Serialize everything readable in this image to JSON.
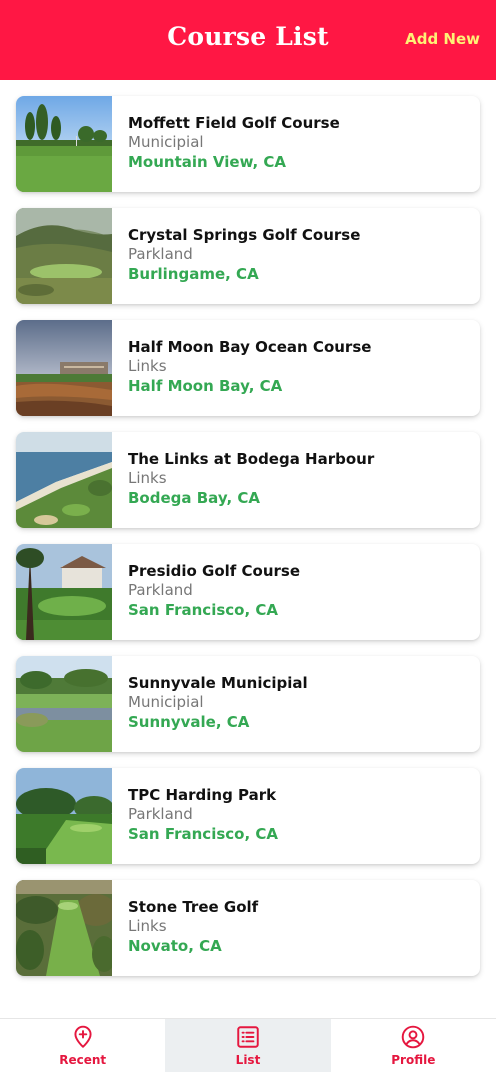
{
  "header": {
    "title": "Course List",
    "add_new_label": "Add New"
  },
  "colors": {
    "header_bg": "#ff1744",
    "add_new": "#fff176",
    "location_text": "#34a853",
    "tab_active_bg": "#eceff1",
    "tab_text": "#e5173f"
  },
  "courses": [
    {
      "name": "Moffett Field Golf Course",
      "type": "Municipial",
      "location": "Mountain View, CA"
    },
    {
      "name": "Crystal Springs Golf Course",
      "type": "Parkland",
      "location": "Burlingame, CA"
    },
    {
      "name": "Half Moon Bay Ocean Course",
      "type": "Links",
      "location": "Half Moon Bay, CA"
    },
    {
      "name": "The Links at Bodega Harbour",
      "type": "Links",
      "location": "Bodega Bay, CA"
    },
    {
      "name": "Presidio Golf Course",
      "type": "Parkland",
      "location": "San Francisco, CA"
    },
    {
      "name": "Sunnyvale Municipial",
      "type": "Municipial",
      "location": "Sunnyvale, CA"
    },
    {
      "name": "TPC Harding Park",
      "type": "Parkland",
      "location": "San Francisco, CA"
    },
    {
      "name": "Stone Tree Golf",
      "type": "Links",
      "location": "Novato, CA"
    }
  ],
  "tabs": [
    {
      "label": "Recent",
      "icon": "map-pin-plus-icon",
      "active": false
    },
    {
      "label": "List",
      "icon": "list-icon",
      "active": true
    },
    {
      "label": "Profile",
      "icon": "user-circle-icon",
      "active": false
    }
  ]
}
